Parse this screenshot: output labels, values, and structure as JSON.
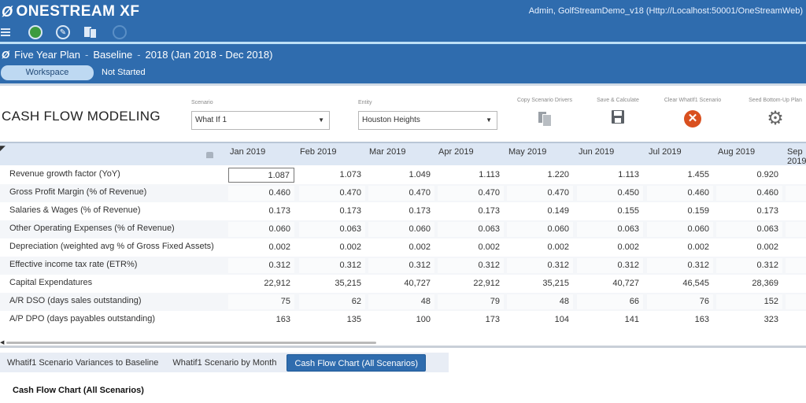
{
  "app": {
    "brand": "ONESTREAM XF",
    "user_info": "Admin, GolfStreamDemo_v18 (Http://Localhost:50001/OneStreamWeb)"
  },
  "toolbar_icons": [
    "menu-icon",
    "status-green-icon",
    "globe-icon",
    "documents-icon",
    "circle-icon"
  ],
  "breadcrumb": {
    "workflow": "Five Year Plan",
    "scenario": "Baseline",
    "period": "2018 (Jan 2018 - Dec 2018)",
    "separator": "-"
  },
  "workspace_button": "Workspace",
  "workflow_status": "Not Started",
  "page": {
    "title": "CASH FLOW MODELING",
    "scenario_label": "Scenario",
    "scenario_value": "What If 1",
    "entity_label": "Entity",
    "entity_value": "Houston Heights",
    "actions": [
      {
        "label": "Copy Scenario Drivers",
        "icon": "copy-icon"
      },
      {
        "label": "Save & Calculate",
        "icon": "save-icon"
      },
      {
        "label": "Clear WhatIf1 Scenario",
        "icon": "clear-icon"
      },
      {
        "label": "Seed Bottom-Up Plan",
        "icon": "gear-icon"
      }
    ]
  },
  "grid": {
    "columns": [
      "Jan 2019",
      "Feb 2019",
      "Mar 2019",
      "Apr 2019",
      "May 2019",
      "Jun 2019",
      "Jul 2019",
      "Aug 2019",
      "Sep 2019"
    ],
    "rows": [
      {
        "label": "Revenue growth factor (YoY)",
        "values": [
          "1.087",
          "1.073",
          "1.049",
          "1.113",
          "1.220",
          "1.113",
          "1.455",
          "0.920",
          ""
        ]
      },
      {
        "label": "Gross Profit Margin (% of Revenue)",
        "values": [
          "0.460",
          "0.470",
          "0.470",
          "0.470",
          "0.470",
          "0.450",
          "0.460",
          "0.460",
          ""
        ]
      },
      {
        "label": "Salaries & Wages (% of Revenue)",
        "values": [
          "0.173",
          "0.173",
          "0.173",
          "0.173",
          "0.149",
          "0.155",
          "0.159",
          "0.173",
          ""
        ]
      },
      {
        "label": "Other Operating Expenses (% of Revenue)",
        "values": [
          "0.060",
          "0.063",
          "0.060",
          "0.063",
          "0.060",
          "0.063",
          "0.060",
          "0.063",
          ""
        ]
      },
      {
        "label": "Depreciation (weighted avg % of Gross Fixed Assets)",
        "values": [
          "0.002",
          "0.002",
          "0.002",
          "0.002",
          "0.002",
          "0.002",
          "0.002",
          "0.002",
          ""
        ]
      },
      {
        "label": "Effective income tax rate (ETR%)",
        "values": [
          "0.312",
          "0.312",
          "0.312",
          "0.312",
          "0.312",
          "0.312",
          "0.312",
          "0.312",
          ""
        ]
      },
      {
        "label": "Capital Expendatures",
        "values": [
          "22,912",
          "35,215",
          "40,727",
          "22,912",
          "35,215",
          "40,727",
          "46,545",
          "28,369",
          ""
        ]
      },
      {
        "label": "A/R DSO (days sales outstanding)",
        "values": [
          "75",
          "62",
          "48",
          "79",
          "48",
          "66",
          "76",
          "152",
          ""
        ]
      },
      {
        "label": "A/P DPO (days payables outstanding)",
        "values": [
          "163",
          "135",
          "100",
          "173",
          "104",
          "141",
          "163",
          "323",
          ""
        ]
      }
    ]
  },
  "tabs": [
    {
      "label": "Whatif1 Scenario Variances to Baseline",
      "active": false
    },
    {
      "label": "Whatif1 Scenario by Month",
      "active": false
    },
    {
      "label": "Cash Flow Chart (All Scenarios)",
      "active": true
    }
  ],
  "section_title": "Cash Flow Chart (All Scenarios)"
}
